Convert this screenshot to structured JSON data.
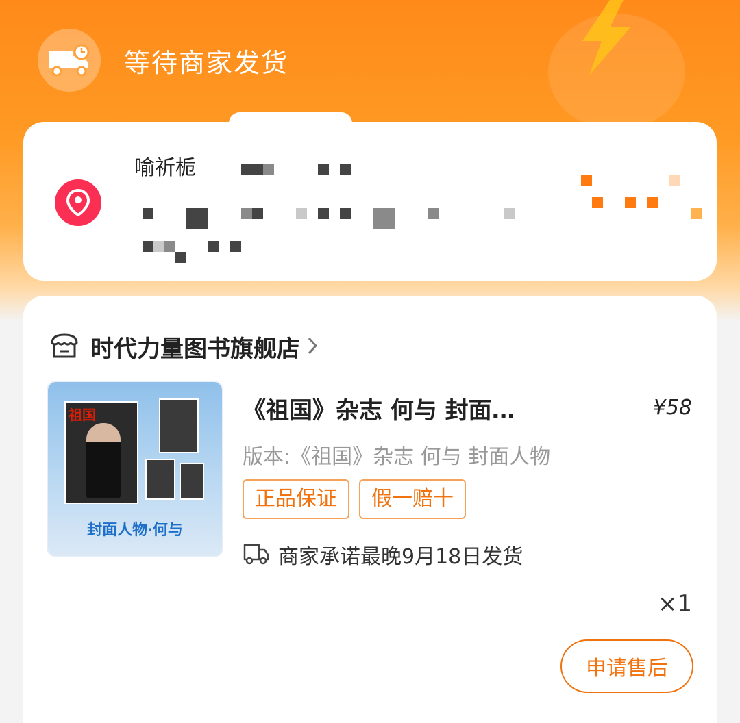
{
  "status": {
    "title": "等待商家发货",
    "icon": "delivery-truck-clock-icon"
  },
  "address": {
    "recipient_name": "喻祈栀",
    "icon": "location-pin-icon"
  },
  "shop": {
    "name": "时代力量图书旗舰店",
    "icon": "shop-awning-icon",
    "chevron": "chevron-right-icon"
  },
  "product": {
    "title": "《祖国》杂志 何与 封面…",
    "price": "¥58",
    "variant": "版本:《祖国》杂志 何与 封面人物",
    "tags": [
      "正品保证",
      "假一赔十"
    ],
    "shipping_promise": "商家承诺最晚9月18日发货",
    "quantity": "×1",
    "thumb_logo": "祖国",
    "thumb_caption": "封面人物·何与"
  },
  "actions": {
    "after_sale": "申请售后"
  },
  "colors": {
    "accent": "#f0730f",
    "header_orange": "#ff8a1a",
    "location_red": "#fb2e53"
  }
}
